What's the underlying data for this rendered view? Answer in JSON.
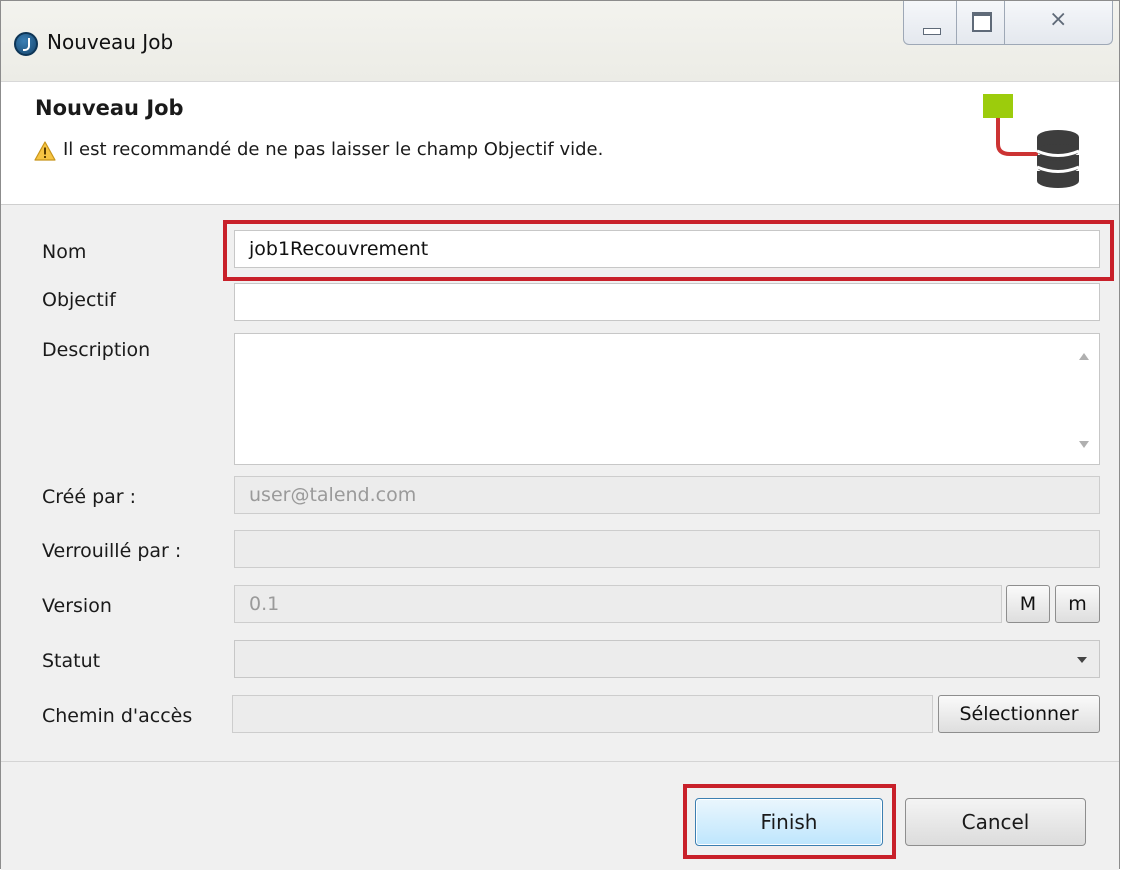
{
  "window": {
    "title": "Nouveau Job",
    "close_glyph": "⨯"
  },
  "header": {
    "title": "Nouveau Job",
    "warning": "Il est recommandé de ne pas laisser le champ Objectif vide.",
    "icon": "job-database-icon"
  },
  "form": {
    "name_label": "Nom",
    "name_value": "job1Recouvrement",
    "purpose_label": "Objectif",
    "purpose_value": "",
    "description_label": "Description",
    "description_value": "",
    "author_label": "Créé par :",
    "author_value": "user@talend.com",
    "locker_label": "Verrouillé par :",
    "locker_value": "",
    "version_label": "Version",
    "version_value": "0.1",
    "version_major_button": "M",
    "version_minor_button": "m",
    "status_label": "Statut",
    "status_value": "",
    "path_label": "Chemin d'accès",
    "path_value": "",
    "select_button": "Sélectionner"
  },
  "footer": {
    "finish_label": "Finish",
    "cancel_label": "Cancel"
  },
  "colors": {
    "highlight": "#c8202a",
    "finish_button": "#bee6fd",
    "job_icon_green": "#9ccc0c",
    "job_icon_link": "#cc3333",
    "db_icon": "#3d3d3d"
  }
}
